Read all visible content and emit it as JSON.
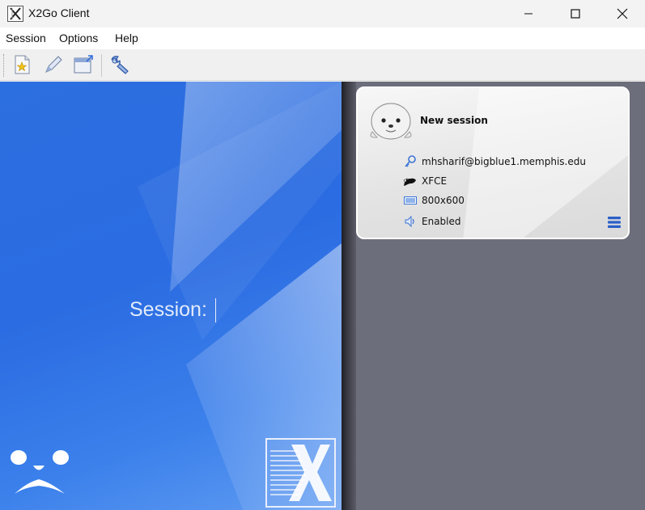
{
  "window": {
    "title": "X2Go Client"
  },
  "menubar": {
    "items": [
      {
        "label": "Session"
      },
      {
        "label": "Options"
      },
      {
        "label": "Help"
      }
    ]
  },
  "toolbar": {
    "tools": [
      {
        "icon": "new-session-icon"
      },
      {
        "icon": "edit-session-icon"
      },
      {
        "icon": "session-shortcut-icon"
      },
      {
        "icon": "preferences-wrench-icon"
      }
    ]
  },
  "login": {
    "session_label": "Session:",
    "session_value": ""
  },
  "session_card": {
    "name": "New session",
    "server": "mhsharif@bigblue1.memphis.edu",
    "desktop": "XFCE",
    "resolution": "800x600",
    "sound": "Enabled"
  },
  "colors": {
    "left_panel": "#2b6ce2",
    "right_panel": "#6d6e7b",
    "menu_button": "#2a5fc9"
  }
}
